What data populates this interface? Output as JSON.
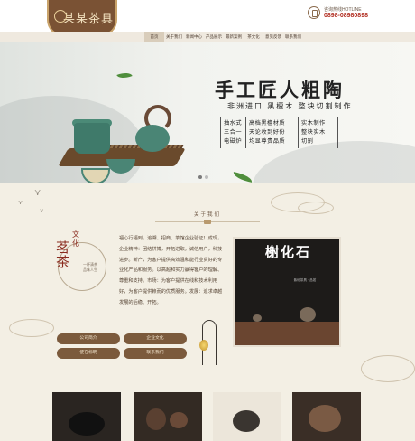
{
  "header": {
    "logo_text": "某某茶具",
    "hotline_label": "咨询热线HOTLINE",
    "hotline_number": "0898-08980898"
  },
  "nav": {
    "items": [
      {
        "label": "首页",
        "active": true
      },
      {
        "label": "关于我们",
        "active": false
      },
      {
        "label": "新闻中心",
        "active": false
      },
      {
        "label": "产品展示",
        "active": false
      },
      {
        "label": "最新案例",
        "active": false
      },
      {
        "label": "茶文化",
        "active": false
      },
      {
        "label": "意见反馈",
        "active": false
      },
      {
        "label": "联系我们",
        "active": false
      }
    ]
  },
  "banner": {
    "title": "手工匠人粗陶",
    "subtitle": "非洲进口 黑檀木 整块切割制作",
    "columns": [
      [
        "抽水式",
        "三合一",
        "电磁炉"
      ],
      [
        "高档黑檀材质",
        "天论收到好份",
        "均显尊贵品质"
      ],
      [
        "实木制作",
        "整块实木",
        "切割"
      ]
    ],
    "slide_count": 2,
    "active_slide": 1
  },
  "about": {
    "section_title": "关于我们",
    "side_big": "茗茶",
    "side_small": "文化",
    "side_poem": "一杯清茶 品味人生",
    "paragraph": "福心行福到，追溯、招商、茶馆企业验证！成现，企业精神：团结拼搏，开拓进取。诚信用户，科技进步。新产，为客户提供高效温和能行业贸好的专业化产品和服务。以高超和实力赢得客户的理解、尊重和支持。市场：为客户提供在线和技术利用好，为客户提供赖而的优质服务。发展：追求卓越发展的后稳、开拓。",
    "buttons": [
      "公司简介",
      "企业文化",
      "使在标明",
      "联系我们"
    ]
  },
  "photo": {
    "title": "榭化石",
    "subtitle": "紫砂茶具 · 品茗"
  },
  "colors": {
    "accent_brown": "#7b5a3c",
    "hotline_red": "#b02b1e",
    "banner_ink": "#222222",
    "teal_ceramic": "#4a8575"
  },
  "icons": [
    "logo-icon",
    "phone-icon",
    "bird-icon",
    "leaf-icon"
  ]
}
